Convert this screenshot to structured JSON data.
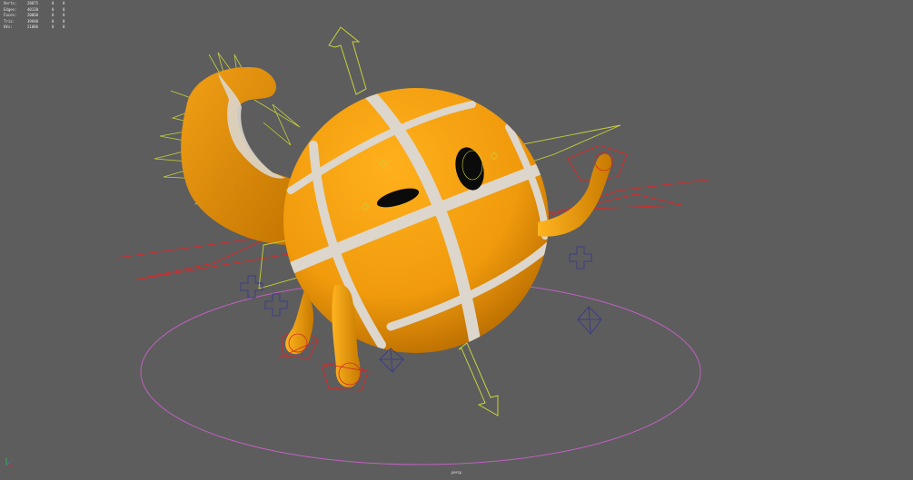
{
  "hud": {
    "rows": [
      {
        "label": "Verts:",
        "value": "20075",
        "c1": "0",
        "c2": "0"
      },
      {
        "label": "Edges:",
        "value": "40120",
        "c1": "0",
        "c2": "0"
      },
      {
        "label": "Faces:",
        "value": "20060",
        "c1": "0",
        "c2": "0"
      },
      {
        "label": "Tris:",
        "value": "39940",
        "c1": "0",
        "c2": "0"
      },
      {
        "label": "UVs:",
        "value": "21086",
        "c1": "0",
        "c2": "0"
      }
    ]
  },
  "camera_label": "persp",
  "colors": {
    "viewport_bg": "#5d5d5d",
    "body": "#f0a010",
    "body_dark": "#c67800",
    "stripe": "#dcd6cc",
    "eye": "#0b0b0b",
    "control_yellow": "#c7d13a",
    "control_red": "#d12a2a",
    "locator_blue": "#3d3d86",
    "ground_circle": "#c060c0"
  },
  "icons": {
    "axis_gizmo": "axis-gizmo-icon"
  }
}
